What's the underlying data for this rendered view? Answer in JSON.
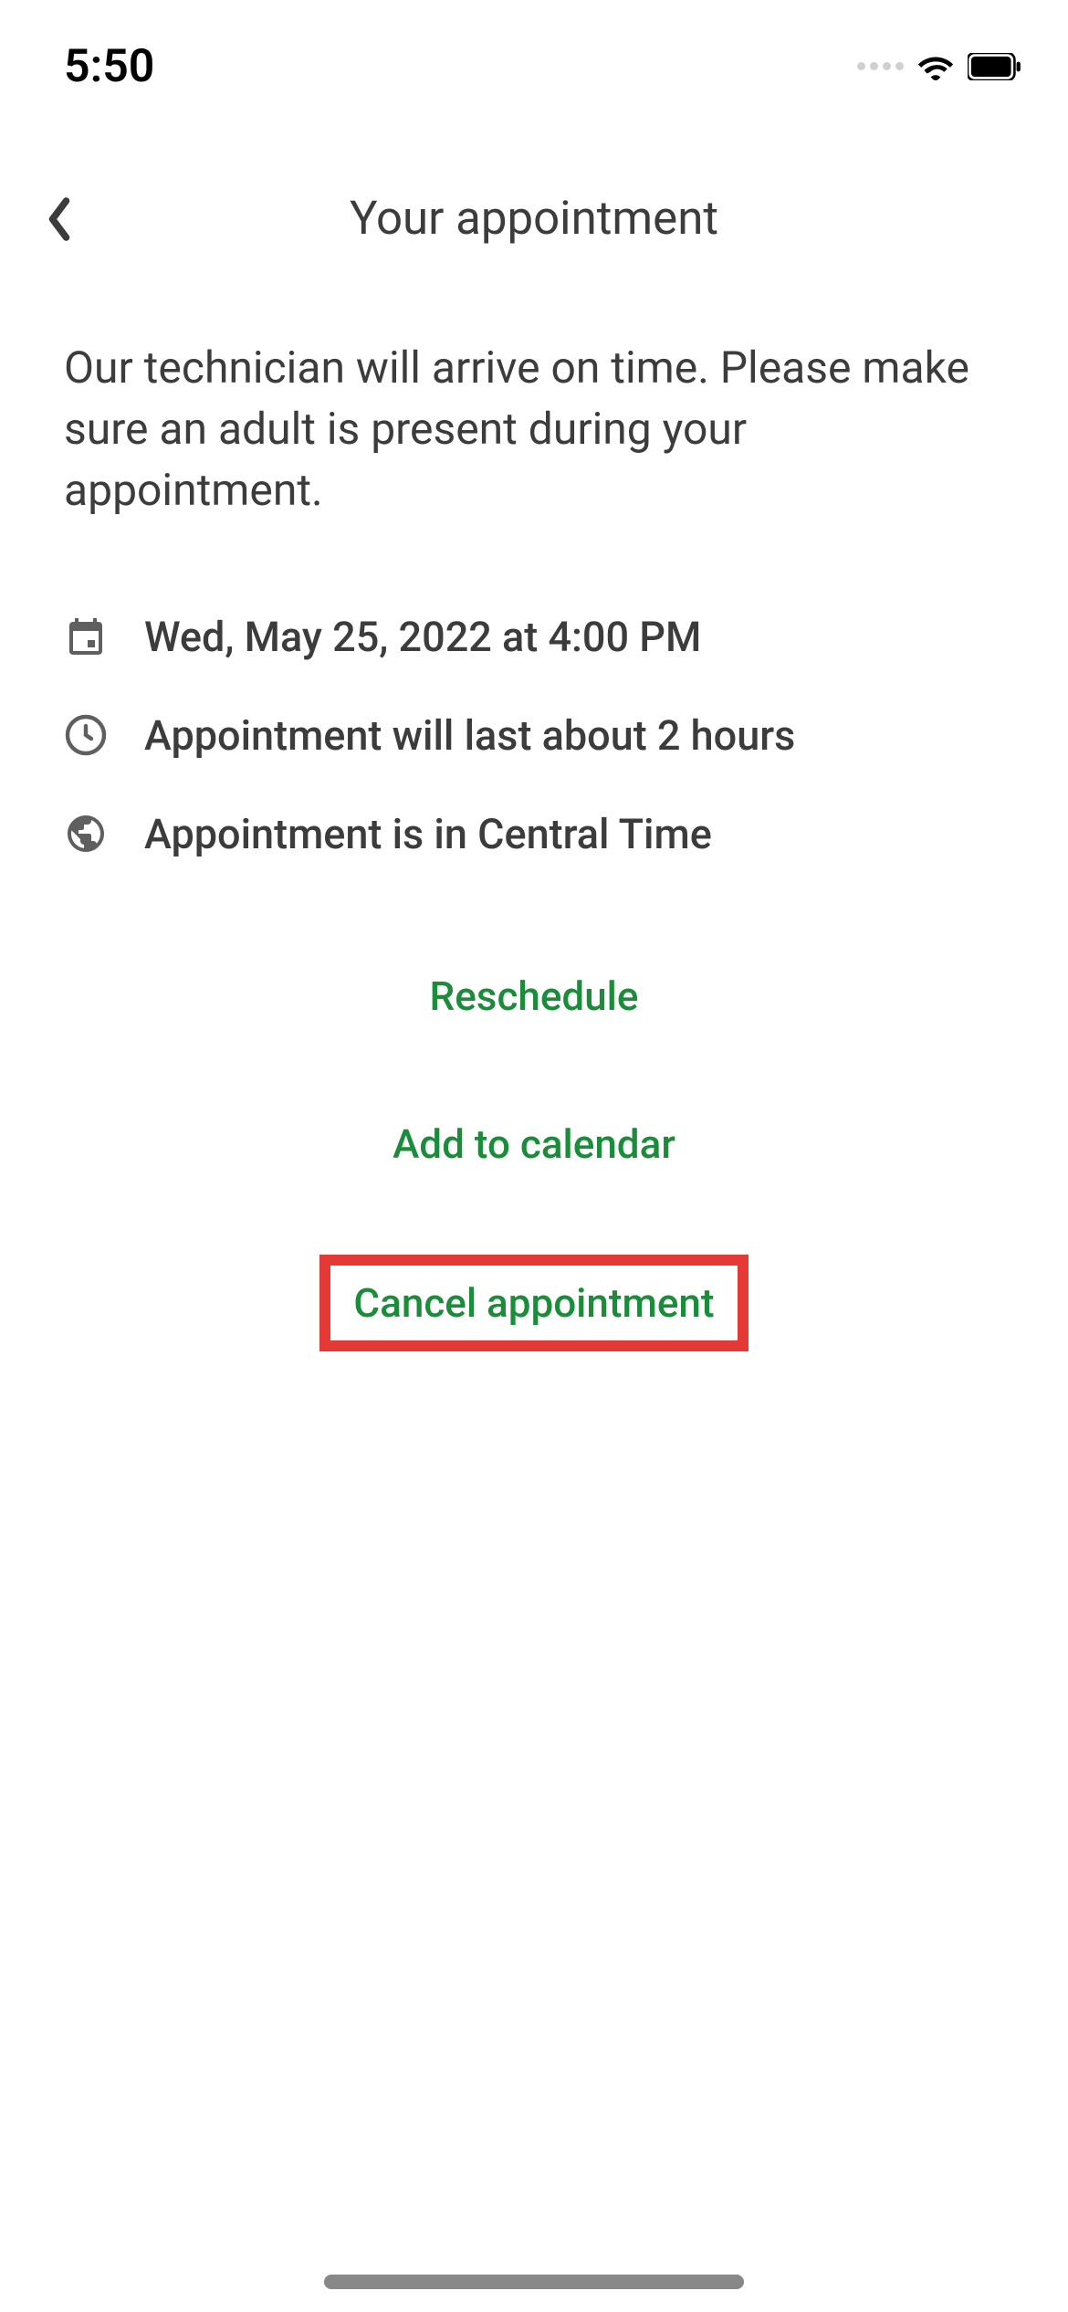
{
  "statusBar": {
    "time": "5:50"
  },
  "header": {
    "title": "Your appointment"
  },
  "content": {
    "description": "Our technician will arrive on time. Please make sure an adult is present during your appointment.",
    "details": {
      "datetime": "Wed, May 25, 2022 at 4:00 PM",
      "duration": "Appointment will last about 2 hours",
      "timezone": "Appointment is in Central Time"
    },
    "actions": {
      "reschedule": "Reschedule",
      "addToCalendar": "Add to calendar",
      "cancel": "Cancel appointment"
    }
  }
}
